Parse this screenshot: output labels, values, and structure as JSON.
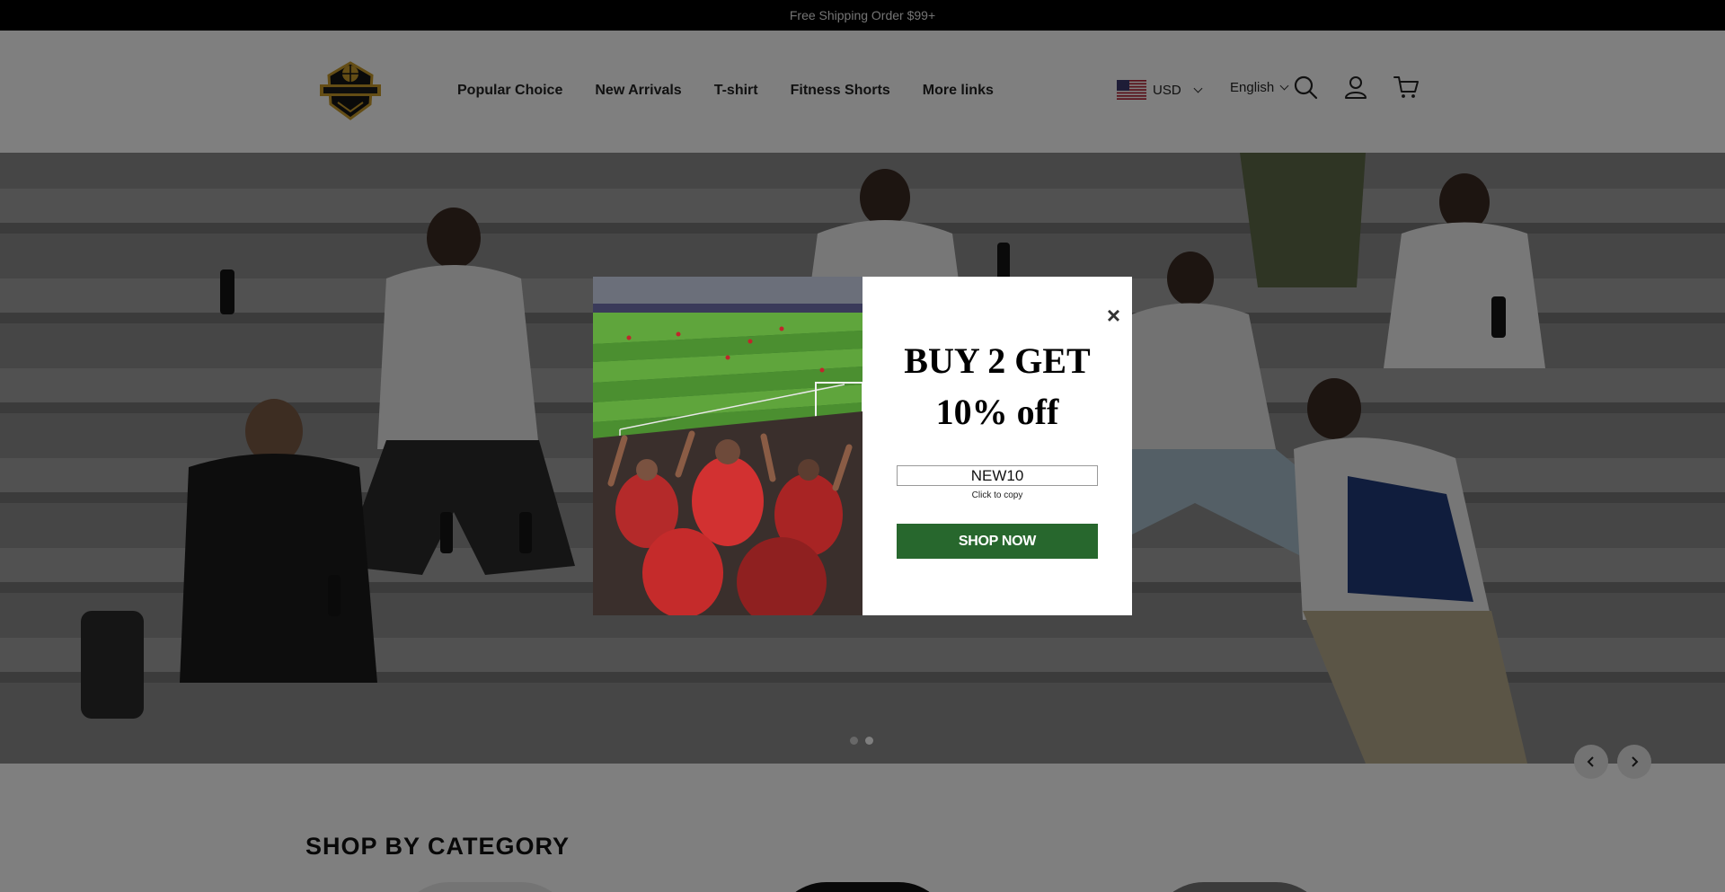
{
  "announcement": {
    "text": "Free Shipping Order $99+"
  },
  "brand": {
    "logo_alt": "BALLINBALL"
  },
  "nav": {
    "items": [
      {
        "label": "Popular Choice"
      },
      {
        "label": "New Arrivals"
      },
      {
        "label": "T-shirt"
      },
      {
        "label": "Fitness Shorts"
      },
      {
        "label": "More links"
      }
    ]
  },
  "header_tools": {
    "currency": "USD",
    "language": "English"
  },
  "icons": {
    "search": "search-icon",
    "account": "user-icon",
    "cart": "cart-icon",
    "flag": "us-flag-icon",
    "prev": "chevron-left-icon",
    "next": "chevron-right-icon"
  },
  "hero": {
    "slide_count": 2,
    "active_slide": 2
  },
  "sections": {
    "category_title": "SHOP BY CATEGORY"
  },
  "popup": {
    "headline_line1": "BUY 2 GET",
    "headline_line2": "10% off",
    "code": "NEW10",
    "copy_hint": "Click to copy",
    "cta": "SHOP NOW",
    "close": "×"
  },
  "colors": {
    "announce_bg": "#000000",
    "cta_bg": "#27672d",
    "overlay": "rgba(0,0,0,0.5)"
  }
}
